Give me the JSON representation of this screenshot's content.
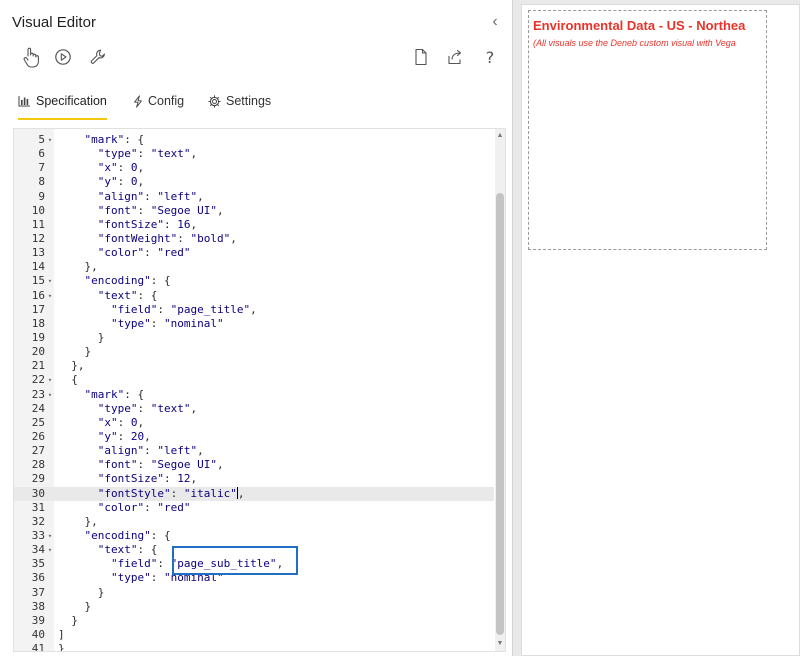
{
  "panel": {
    "title": "Visual Editor",
    "collapse_glyph": "‹"
  },
  "toolbar": {
    "icons": [
      "hand-pointer-icon",
      "play-circle-icon",
      "wrench-icon",
      "new-file-icon",
      "share-icon",
      "help-icon"
    ],
    "help_label": "?"
  },
  "tabs": [
    {
      "label": "Specification",
      "icon": "bar-chart-icon",
      "active": true
    },
    {
      "label": "Config",
      "icon": "lightning-icon",
      "active": false
    },
    {
      "label": "Settings",
      "icon": "gear-icon",
      "active": false
    }
  ],
  "editor": {
    "current_line": 30,
    "lines": [
      {
        "n": "5",
        "fold": true,
        "text": "    \"mark\": {"
      },
      {
        "n": "6",
        "fold": false,
        "text": "      \"type\": \"text\","
      },
      {
        "n": "7",
        "fold": false,
        "text": "      \"x\": 0,"
      },
      {
        "n": "8",
        "fold": false,
        "text": "      \"y\": 0,"
      },
      {
        "n": "9",
        "fold": false,
        "text": "      \"align\": \"left\","
      },
      {
        "n": "10",
        "fold": false,
        "text": "      \"font\": \"Segoe UI\","
      },
      {
        "n": "11",
        "fold": false,
        "text": "      \"fontSize\": 16,"
      },
      {
        "n": "12",
        "fold": false,
        "text": "      \"fontWeight\": \"bold\","
      },
      {
        "n": "13",
        "fold": false,
        "text": "      \"color\": \"red\""
      },
      {
        "n": "14",
        "fold": false,
        "text": "    },"
      },
      {
        "n": "15",
        "fold": true,
        "text": "    \"encoding\": {"
      },
      {
        "n": "16",
        "fold": true,
        "text": "      \"text\": {"
      },
      {
        "n": "17",
        "fold": false,
        "text": "        \"field\": \"page_title\","
      },
      {
        "n": "18",
        "fold": false,
        "text": "        \"type\": \"nominal\""
      },
      {
        "n": "19",
        "fold": false,
        "text": "      }"
      },
      {
        "n": "20",
        "fold": false,
        "text": "    }"
      },
      {
        "n": "21",
        "fold": false,
        "text": "  },"
      },
      {
        "n": "22",
        "fold": true,
        "text": "  {"
      },
      {
        "n": "23",
        "fold": true,
        "text": "    \"mark\": {"
      },
      {
        "n": "24",
        "fold": false,
        "text": "      \"type\": \"text\","
      },
      {
        "n": "25",
        "fold": false,
        "text": "      \"x\": 0,"
      },
      {
        "n": "26",
        "fold": false,
        "text": "      \"y\": 20,"
      },
      {
        "n": "27",
        "fold": false,
        "text": "      \"align\": \"left\","
      },
      {
        "n": "28",
        "fold": false,
        "text": "      \"font\": \"Segoe UI\","
      },
      {
        "n": "29",
        "fold": false,
        "text": "      \"fontSize\": 12,"
      },
      {
        "n": "30",
        "fold": false,
        "text": "      \"fontStyle\": \"italic\","
      },
      {
        "n": "31",
        "fold": false,
        "text": "      \"color\": \"red\""
      },
      {
        "n": "32",
        "fold": false,
        "text": "    },"
      },
      {
        "n": "33",
        "fold": true,
        "text": "    \"encoding\": {"
      },
      {
        "n": "34",
        "fold": true,
        "text": "      \"text\": {"
      },
      {
        "n": "35",
        "fold": false,
        "text": "        \"field\": \"page_sub_title\","
      },
      {
        "n": "36",
        "fold": false,
        "text": "        \"type\": \"nominal\""
      },
      {
        "n": "37",
        "fold": false,
        "text": "      }"
      },
      {
        "n": "38",
        "fold": false,
        "text": "    }"
      },
      {
        "n": "39",
        "fold": false,
        "text": "  }"
      },
      {
        "n": "40",
        "fold": false,
        "text": "]"
      },
      {
        "n": "41",
        "fold": false,
        "text": "}"
      }
    ]
  },
  "preview": {
    "title": "Environmental Data - US - Northea",
    "subtitle": "(All visuals use the Deneb custom visual with Vega",
    "text_color": "#e8332b"
  },
  "colors": {
    "accent_tab_underline": "#f2c811",
    "highlight_box": "#1f6fc5",
    "code_token": "#0b0080"
  }
}
